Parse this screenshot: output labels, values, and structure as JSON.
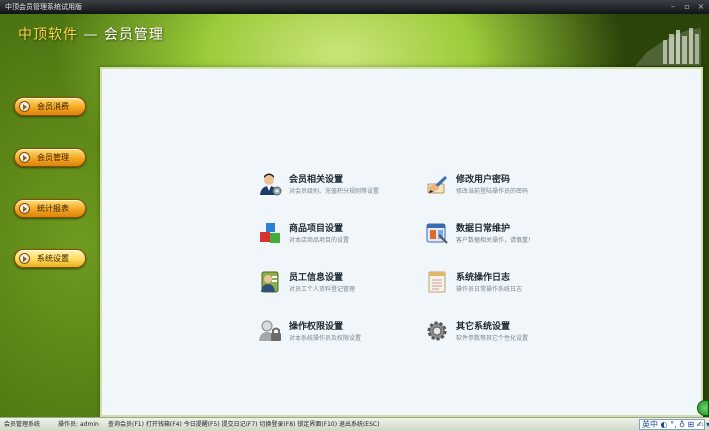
{
  "window": {
    "title": "中顶会员管理系统试用版",
    "buttons": [
      "–",
      "▫",
      "×"
    ]
  },
  "header": {
    "brand": "中顶软件",
    "separator": " — ",
    "module": "会员管理"
  },
  "sidebar": {
    "items": [
      {
        "label": "会员消费"
      },
      {
        "label": "会员管理"
      },
      {
        "label": "统计报表"
      },
      {
        "label": "系统设置"
      }
    ]
  },
  "settings": {
    "items": [
      {
        "title": "会员相关设置",
        "desc": "对会员级别、充值积分规则等设置",
        "icon": "person-settings-icon"
      },
      {
        "title": "修改用户密码",
        "desc": "修改当前登陆操作员的密码",
        "icon": "pen-hand-icon"
      },
      {
        "title": "商品项目设置",
        "desc": "对本店商品项目的设置",
        "icon": "colored-cubes-icon"
      },
      {
        "title": "数据日常维护",
        "desc": "客户数据相关操作，请慎重！",
        "icon": "database-tools-icon"
      },
      {
        "title": "员工信息设置",
        "desc": "对员工个人资料登记管理",
        "icon": "employee-card-icon"
      },
      {
        "title": "系统操作日志",
        "desc": "操作员日常操作系统日志",
        "icon": "log-sheet-icon"
      },
      {
        "title": "操作权限设置",
        "desc": "对本系统操作员及权限设置",
        "icon": "user-lock-icon"
      },
      {
        "title": "其它系统设置",
        "desc": "软件参数等其它个性化设置",
        "icon": "gear-icon"
      }
    ]
  },
  "statusbar": {
    "system": "会员管理系统",
    "operator_label": "操作员:",
    "operator": "admin",
    "shortcuts": "查询会员(F1)  打开钱箱(F4)  今日提醒(F5)  提交日记(F7)  切换登录(F8)  锁定界面(F10)  退出系统(ESC)",
    "ime": "英中 ◐ °, ♁ ⊞ ✍ ▾"
  }
}
